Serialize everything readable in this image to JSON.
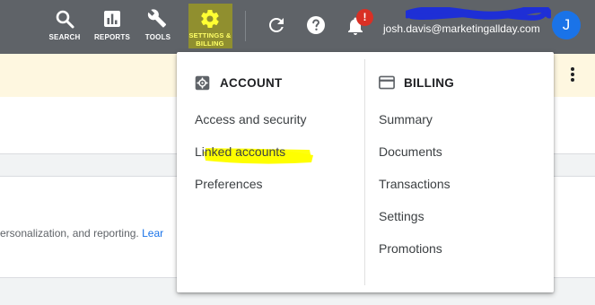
{
  "toolbar": {
    "tools": [
      {
        "label": "SEARCH",
        "icon": "search-icon"
      },
      {
        "label": "REPORTS",
        "icon": "reports-icon"
      },
      {
        "label": "TOOLS",
        "icon": "wrench-icon"
      },
      {
        "label_line1": "SETTINGS &",
        "label_line2": "BILLING",
        "icon": "gear-icon",
        "active": true
      }
    ],
    "refresh_icon": "refresh-icon",
    "help_icon": "help-icon",
    "notifications_icon": "bell-icon",
    "notification_badge": "!",
    "account_email": "josh.davis@marketingallday.com",
    "avatar_initial": "J"
  },
  "page": {
    "body_text": "ersonalization, and reporting.",
    "body_link": "Lear"
  },
  "menu": {
    "account": {
      "heading": "ACCOUNT",
      "icon": "gear-square-icon",
      "items": [
        "Access and security",
        "Linked accounts",
        "Preferences"
      ]
    },
    "billing": {
      "heading": "BILLING",
      "icon": "credit-card-icon",
      "items": [
        "Summary",
        "Documents",
        "Transactions",
        "Settings",
        "Promotions"
      ]
    }
  },
  "colors": {
    "topbar": "#5f6368",
    "highlight": "#ffff00",
    "menu_text": "#3c4043",
    "avatar": "#1a73e8",
    "badge": "#d93025",
    "notice_banner": "#fef7e0"
  }
}
